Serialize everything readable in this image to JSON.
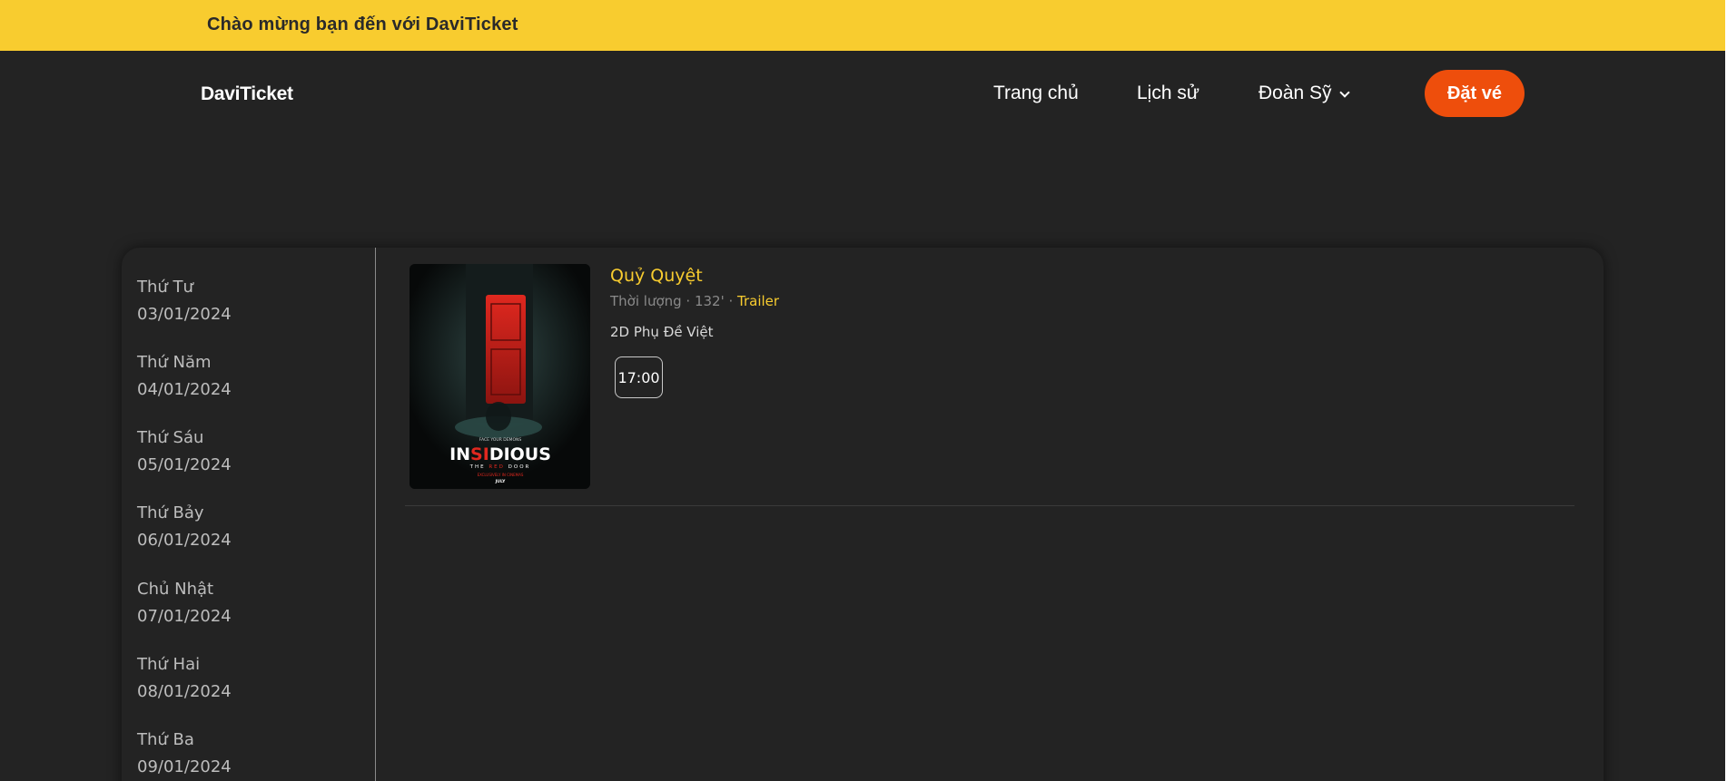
{
  "welcome": {
    "text": "Chào mừng bạn đến với DaviTicket"
  },
  "header": {
    "logo": "DaviTicket",
    "nav": {
      "home": "Trang chủ",
      "history": "Lịch sử",
      "user": "Đoàn Sỹ"
    },
    "book_button": "Đặt vé"
  },
  "dates": [
    {
      "day": "Thứ Tư",
      "date": "03/01/2024"
    },
    {
      "day": "Thứ Năm",
      "date": "04/01/2024"
    },
    {
      "day": "Thứ Sáu",
      "date": "05/01/2024"
    },
    {
      "day": "Thứ Bảy",
      "date": "06/01/2024"
    },
    {
      "day": "Chủ Nhật",
      "date": "07/01/2024"
    },
    {
      "day": "Thứ Hai",
      "date": "08/01/2024"
    },
    {
      "day": "Thứ Ba",
      "date": "09/01/2024"
    }
  ],
  "movie": {
    "title": "Quỷ Quyệt",
    "duration_text": "Thời lượng · 132' · ",
    "trailer_label": "Trailer",
    "format": "2D Phụ Đề Việt",
    "showtimes": [
      "17:00"
    ],
    "poster": {
      "tagline": "FACE YOUR DEMONS",
      "title_pre": "IN",
      "title_highlight": "SI",
      "title_post": "DIOUS",
      "subtitle_pre": "THE ",
      "subtitle_highlight": "RED",
      "subtitle_post": " DOOR",
      "release_note": "EXCLUSIVELY IN CINEMAS",
      "month": "JULY"
    }
  },
  "colors": {
    "accent": "#f8cc2f",
    "cta": "#ee4e0c",
    "background": "#232323"
  }
}
